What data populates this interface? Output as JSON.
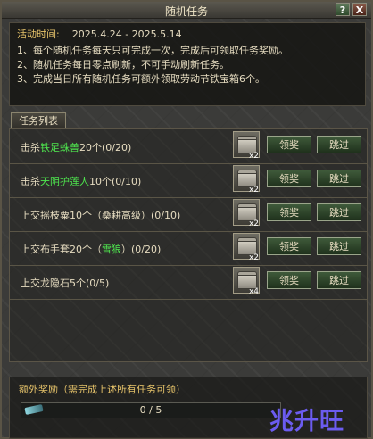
{
  "window": {
    "title": "随机任务",
    "help_label": "?",
    "close_label": "X"
  },
  "info": {
    "activity_label": "活动时间:",
    "activity_dates": "2025.4.24 - 2025.5.14",
    "rules": [
      "1、每个随机任务每天只可完成一次，完成后可领取任务奖励。",
      "2、随机任务每日零点刷新，不可手动刷新任务。",
      "3、完成当日所有随机任务可额外领取劳动节铁宝箱6个。"
    ]
  },
  "tab_label": "任务列表",
  "tasks": [
    {
      "pre": "击杀",
      "target": "铁足蛛兽",
      "post": "20个(0/20)",
      "qty": "x2",
      "claim_label": "领奖",
      "skip_label": "跳过"
    },
    {
      "pre": "击杀",
      "target": "天阴护莲人",
      "post": "10个(0/10)",
      "qty": "x2",
      "claim_label": "领奖",
      "skip_label": "跳过"
    },
    {
      "pre": "上交摇枝粟10个（桑耕高级）(0/10)",
      "target": "",
      "post": "",
      "qty": "x2",
      "claim_label": "领奖",
      "skip_label": "跳过"
    },
    {
      "pre": "上交布手套20个（",
      "target": "雪狼",
      "post": "）(0/20)",
      "qty": "x2",
      "claim_label": "领奖",
      "skip_label": "跳过"
    },
    {
      "pre": "上交龙隐石5个(0/5)",
      "target": "",
      "post": "",
      "qty": "x4",
      "claim_label": "领奖",
      "skip_label": "跳过"
    }
  ],
  "extra": {
    "label": "额外奖励（需完成上述所有任务可领）",
    "progress_text": "0 / 5",
    "progress_fraction": 0
  },
  "watermark": "兆升旺",
  "colors": {
    "highlight_green": "#4ee64e",
    "gold_label": "#e6c36a"
  },
  "icons": {
    "chest": "treasure-chest-icon",
    "sword": "sword-icon"
  }
}
